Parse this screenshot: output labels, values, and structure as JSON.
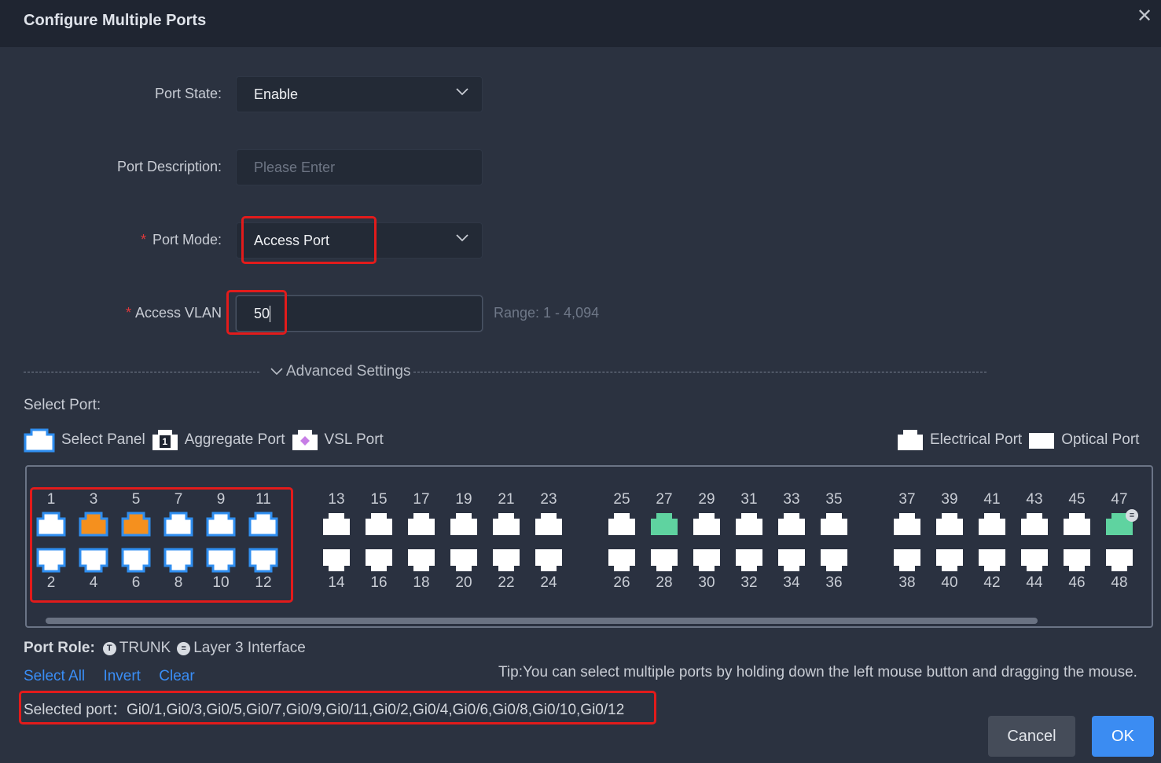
{
  "dialog": {
    "title": "Configure Multiple Ports",
    "close_glyph": "✕"
  },
  "form": {
    "port_state": {
      "label": "Port State:",
      "value": "Enable"
    },
    "port_description": {
      "label": "Port Description:",
      "placeholder": "Please Enter"
    },
    "port_mode": {
      "required_mark": "*",
      "label": "Port Mode:",
      "value": "Access Port"
    },
    "access_vlan": {
      "required_mark": "*",
      "label": "Access VLAN",
      "value": "50",
      "range": "Range: 1 - 4,094"
    }
  },
  "advanced_settings": {
    "label": "Advanced Settings"
  },
  "select_port": {
    "label": "Select Port:",
    "legend": {
      "select_panel": "Select Panel",
      "aggregate_badge": "1",
      "aggregate_port": "Aggregate Port",
      "vsl_port": "VSL Port",
      "electrical_port": "Electrical Port",
      "optical_port": "Optical Port"
    }
  },
  "ports": {
    "top_row": [
      "1",
      "3",
      "5",
      "7",
      "9",
      "11",
      "13",
      "15",
      "17",
      "19",
      "21",
      "23",
      "25",
      "27",
      "29",
      "31",
      "33",
      "35",
      "37",
      "39",
      "41",
      "43",
      "45",
      "47"
    ],
    "bottom_row": [
      "2",
      "4",
      "6",
      "8",
      "10",
      "12",
      "14",
      "16",
      "18",
      "20",
      "22",
      "24",
      "26",
      "28",
      "30",
      "32",
      "34",
      "36",
      "38",
      "40",
      "42",
      "44",
      "46",
      "48"
    ],
    "selected": [
      "1",
      "2",
      "3",
      "4",
      "5",
      "6",
      "7",
      "8",
      "9",
      "10",
      "11",
      "12"
    ],
    "aggregate": [
      "3",
      "5"
    ],
    "up": [
      "27",
      "47"
    ],
    "l3_badge_port": "47"
  },
  "port_role": {
    "label": "Port Role:",
    "trunk_badge": "T",
    "trunk": "TRUNK",
    "l3_badge": "≡",
    "l3": "Layer 3 Interface"
  },
  "actions": {
    "select_all": "Select All",
    "invert": "Invert",
    "clear": "Clear"
  },
  "tip": "Tip:You can select multiple ports by holding down the left mouse button and dragging the mouse.",
  "selected_ports": "Selected port：Gi0/1,Gi0/3,Gi0/5,Gi0/7,Gi0/9,Gi0/11,Gi0/2,Gi0/4,Gi0/6,Gi0/8,Gi0/10,Gi0/12",
  "buttons": {
    "cancel": "Cancel",
    "ok": "OK"
  },
  "colors": {
    "selected_fill": "#ffffff",
    "selected_border": "#2f8ef0",
    "aggregate_fill": "#f5901e",
    "up_fill": "#5fd3a0",
    "idle_fill": "#ffffff",
    "highlight_box": "#e21b1b"
  }
}
